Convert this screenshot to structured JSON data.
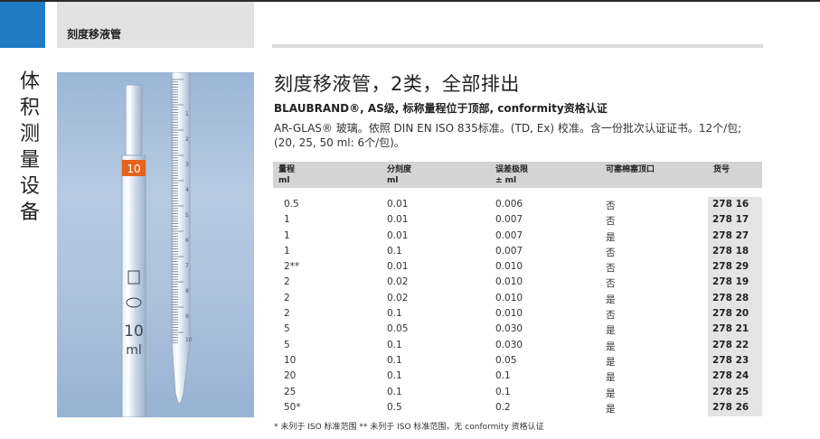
{
  "header": {
    "section_label": "刻度移液管"
  },
  "sidebar": {
    "vertical_title": [
      "体",
      "积",
      "测",
      "量",
      "设",
      "备"
    ]
  },
  "product": {
    "title": "刻度移液管，2类，全部排出",
    "subtitle": "BLAUBRAND®, AS级, 标称量程位于顶部, conformity资格认证",
    "description": "AR-GLAS® 玻璃。依照 DIN EN ISO 835标准。(TD, Ex) 校准。含一份批次认证证书。12个/包; (20, 25, 50 ml: 6个/包)。"
  },
  "photo": {
    "markings": [
      "10",
      "10",
      "ml",
      "1",
      "2",
      "3",
      "4",
      "5",
      "6",
      "7",
      "8",
      "9",
      "10"
    ]
  },
  "table": {
    "headers": [
      {
        "line1": "量程",
        "line2": "ml"
      },
      {
        "line1": "分刻度",
        "line2": "ml"
      },
      {
        "line1": "误差极限",
        "line2": "± ml"
      },
      {
        "line1": "可塞棉塞顶口",
        "line2": ""
      },
      {
        "line1": "货号",
        "line2": ""
      }
    ],
    "rows": [
      {
        "volume": "0.5",
        "graduation": "0.01",
        "tolerance": "0.006",
        "cotton_plug": "否",
        "cat": "278 16"
      },
      {
        "volume": "1",
        "graduation": "0.01",
        "tolerance": "0.007",
        "cotton_plug": "否",
        "cat": "278 17"
      },
      {
        "volume": "1",
        "graduation": "0.01",
        "tolerance": "0.007",
        "cotton_plug": "是",
        "cat": "278 27"
      },
      {
        "volume": "1",
        "graduation": "0.1",
        "tolerance": "0.007",
        "cotton_plug": "否",
        "cat": "278 18"
      },
      {
        "volume": "2**",
        "graduation": "0.01",
        "tolerance": "0.010",
        "cotton_plug": "否",
        "cat": "278 29"
      },
      {
        "volume": "2",
        "graduation": "0.02",
        "tolerance": "0.010",
        "cotton_plug": "否",
        "cat": "278 19"
      },
      {
        "volume": "2",
        "graduation": "0.02",
        "tolerance": "0.010",
        "cotton_plug": "是",
        "cat": "278 28"
      },
      {
        "volume": "2",
        "graduation": "0.1",
        "tolerance": "0.010",
        "cotton_plug": "否",
        "cat": "278 20"
      },
      {
        "volume": "5",
        "graduation": "0.05",
        "tolerance": "0.030",
        "cotton_plug": "是",
        "cat": "278 21"
      },
      {
        "volume": "5",
        "graduation": "0.1",
        "tolerance": "0.030",
        "cotton_plug": "是",
        "cat": "278 22"
      },
      {
        "volume": "10",
        "graduation": "0.1",
        "tolerance": "0.05",
        "cotton_plug": "是",
        "cat": "278 23"
      },
      {
        "volume": "20",
        "graduation": "0.1",
        "tolerance": "0.1",
        "cotton_plug": "是",
        "cat": "278 24"
      },
      {
        "volume": "25",
        "graduation": "0.1",
        "tolerance": "0.1",
        "cotton_plug": "是",
        "cat": "278 25"
      },
      {
        "volume": "50*",
        "graduation": "0.5",
        "tolerance": "0.2",
        "cotton_plug": "是",
        "cat": "278 26"
      }
    ]
  },
  "footnote": "* 未列于 ISO 标准范围 ** 未列于 ISO 标准范围，无 conformity 资格认证",
  "colors": {
    "accent_blue": "#1f7cc4",
    "header_grey": "#d4d4d4",
    "cat_bg": "#e4e4e4",
    "pipette_band": "#e8621c"
  }
}
